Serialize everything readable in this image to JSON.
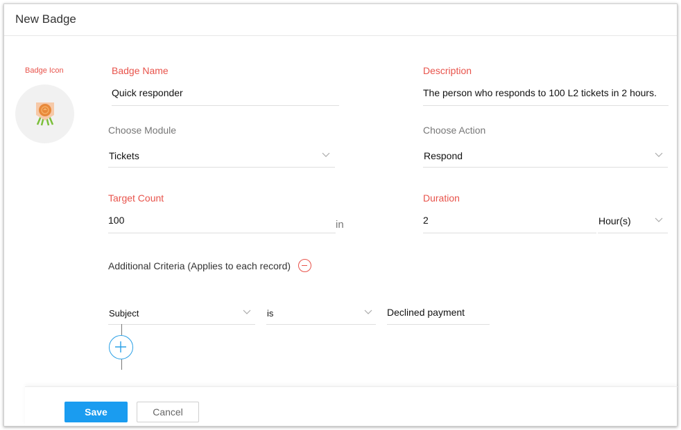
{
  "header": {
    "title": "New Badge"
  },
  "badge_icon": {
    "label": "Badge Icon",
    "icon": "medal-icon"
  },
  "badge_name": {
    "label": "Badge Name",
    "value": "Quick responder"
  },
  "description": {
    "label": "Description",
    "value": "The person who responds to 100 L2 tickets in 2 hours."
  },
  "module": {
    "label": "Choose Module",
    "value": "Tickets"
  },
  "action": {
    "label": "Choose Action",
    "value": "Respond"
  },
  "target_count": {
    "label": "Target Count",
    "value": "100",
    "suffix": "in"
  },
  "duration": {
    "label": "Duration",
    "value": "2",
    "unit": "Hour(s)"
  },
  "criteria": {
    "label": "Additional Criteria (Applies to each record)",
    "field": "Subject",
    "operator": "is",
    "value": "Declined payment"
  },
  "buttons": {
    "save": "Save",
    "cancel": "Cancel"
  },
  "colors": {
    "accent_red": "#e8534b",
    "primary_blue": "#1a9cf0",
    "badge_orange": "#e8893a"
  }
}
